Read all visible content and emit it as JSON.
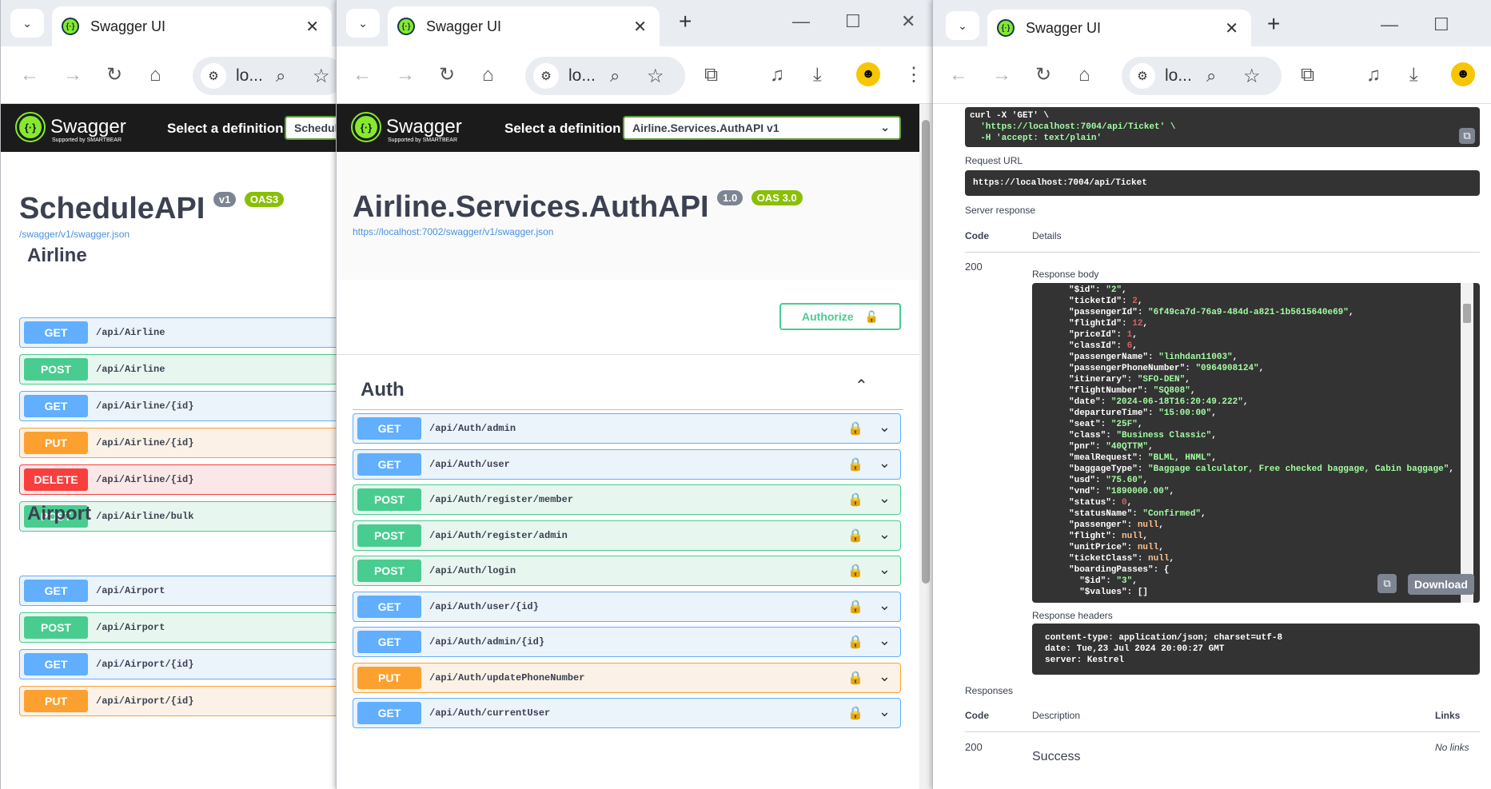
{
  "windows": [
    {
      "tab_title": "Swagger UI",
      "omnibox_text": "lo...",
      "def_label": "Select a definition",
      "def_value": "Schedul",
      "brand": "Swagger",
      "brand_sub": "Supported by SMARTBEAR",
      "api_title": "ScheduleAPI",
      "version": "v1",
      "oas": "OAS3",
      "spec_link": "/swagger/v1/swagger.json",
      "tags": [
        {
          "name": "Airline",
          "ops": [
            {
              "method": "GET",
              "path": "/api/Airline"
            },
            {
              "method": "POST",
              "path": "/api/Airline"
            },
            {
              "method": "GET",
              "path": "/api/Airline/{id}"
            },
            {
              "method": "PUT",
              "path": "/api/Airline/{id}"
            },
            {
              "method": "DELETE",
              "path": "/api/Airline/{id}"
            },
            {
              "method": "POST",
              "path": "/api/Airline/bulk"
            }
          ]
        },
        {
          "name": "Airport",
          "ops": [
            {
              "method": "GET",
              "path": "/api/Airport"
            },
            {
              "method": "POST",
              "path": "/api/Airport"
            },
            {
              "method": "GET",
              "path": "/api/Airport/{id}"
            },
            {
              "method": "PUT",
              "path": "/api/Airport/{id}"
            }
          ]
        }
      ]
    },
    {
      "tab_title": "Swagger UI",
      "omnibox_text": "lo...",
      "def_label": "Select a definition",
      "def_value": "Airline.Services.AuthAPI v1",
      "brand": "Swagger",
      "brand_sub": "Supported by SMARTBEAR",
      "api_title": "Airline.Services.AuthAPI",
      "version": "1.0",
      "oas": "OAS 3.0",
      "spec_link": "https://localhost:7002/swagger/v1/swagger.json",
      "authorize_label": "Authorize",
      "tag": "Auth",
      "ops": [
        {
          "method": "GET",
          "path": "/api/Auth/admin"
        },
        {
          "method": "GET",
          "path": "/api/Auth/user"
        },
        {
          "method": "POST",
          "path": "/api/Auth/register/member"
        },
        {
          "method": "POST",
          "path": "/api/Auth/register/admin"
        },
        {
          "method": "POST",
          "path": "/api/Auth/login"
        },
        {
          "method": "GET",
          "path": "/api/Auth/user/{id}"
        },
        {
          "method": "GET",
          "path": "/api/Auth/admin/{id}"
        },
        {
          "method": "PUT",
          "path": "/api/Auth/updatePhoneNumber"
        },
        {
          "method": "GET",
          "path": "/api/Auth/currentUser"
        }
      ]
    },
    {
      "tab_title": "Swagger UI",
      "omnibox_text": "lo...",
      "curl_lines": [
        "curl -X 'GET' \\",
        "  'https://localhost:7004/api/Ticket' \\",
        "  -H 'accept: text/plain'"
      ],
      "request_url_label": "Request URL",
      "request_url": "https://localhost:7004/api/Ticket",
      "server_response_label": "Server response",
      "code_header": "Code",
      "details_header": "Details",
      "status_code": "200",
      "response_body_label": "Response body",
      "response_body": [
        [
          "\"$id\"",
          ": ",
          "\"2\"",
          "s"
        ],
        [
          "\"ticketId\"",
          ": ",
          "2",
          "n"
        ],
        [
          "\"passengerId\"",
          ": ",
          "\"6f49ca7d-76a9-484d-a821-1b5615640e69\"",
          "s"
        ],
        [
          "\"flightId\"",
          ": ",
          "12",
          "n"
        ],
        [
          "\"priceId\"",
          ": ",
          "1",
          "n"
        ],
        [
          "\"classId\"",
          ": ",
          "6",
          "n"
        ],
        [
          "\"passengerName\"",
          ": ",
          "\"linhdan11003\"",
          "s"
        ],
        [
          "\"passengerPhoneNumber\"",
          ": ",
          "\"0964908124\"",
          "s"
        ],
        [
          "\"itinerary\"",
          ": ",
          "\"SFO-DEN\"",
          "s"
        ],
        [
          "\"flightNumber\"",
          ": ",
          "\"SQ808\"",
          "s"
        ],
        [
          "\"date\"",
          ": ",
          "\"2024-06-18T16:20:49.222\"",
          "s"
        ],
        [
          "\"departureTime\"",
          ": ",
          "\"15:00:00\"",
          "s"
        ],
        [
          "\"seat\"",
          ": ",
          "\"25F\"",
          "s"
        ],
        [
          "\"class\"",
          ": ",
          "\"Business Classic\"",
          "s"
        ],
        [
          "\"pnr\"",
          ": ",
          "\"40QTTM\"",
          "s"
        ],
        [
          "\"mealRequest\"",
          ": ",
          "\"BLML, HNML\"",
          "s"
        ],
        [
          "\"baggageType\"",
          ": ",
          "\"Baggage calculator, Free checked baggage, Cabin baggage\"",
          "s"
        ],
        [
          "\"usd\"",
          ": ",
          "\"75.60\"",
          "s"
        ],
        [
          "\"vnd\"",
          ": ",
          "\"1890000.00\"",
          "s"
        ],
        [
          "\"status\"",
          ": ",
          "0",
          "n"
        ],
        [
          "\"statusName\"",
          ": ",
          "\"Confirmed\"",
          "s"
        ],
        [
          "\"passenger\"",
          ": ",
          "null",
          "k"
        ],
        [
          "\"flight\"",
          ": ",
          "null",
          "k"
        ],
        [
          "\"unitPrice\"",
          ": ",
          "null",
          "k"
        ],
        [
          "\"ticketClass\"",
          ": ",
          "null",
          "k"
        ],
        [
          "\"boardingPasses\"",
          ": {",
          "",
          "s"
        ],
        [
          "  \"$id\"",
          ": ",
          "\"3\"",
          "s"
        ],
        [
          "  \"$values\"",
          ": []",
          "",
          "s"
        ]
      ],
      "download_label": "Download",
      "response_headers_label": "Response headers",
      "response_headers": [
        "content-type: application/json; charset=utf-8",
        "date: Tue,23 Jul 2024 20:00:27 GMT",
        "server: Kestrel"
      ],
      "responses_label": "Responses",
      "description_header": "Description",
      "links_header": "Links",
      "resp_code": "200",
      "resp_desc": "Success",
      "resp_links": "No links"
    }
  ]
}
